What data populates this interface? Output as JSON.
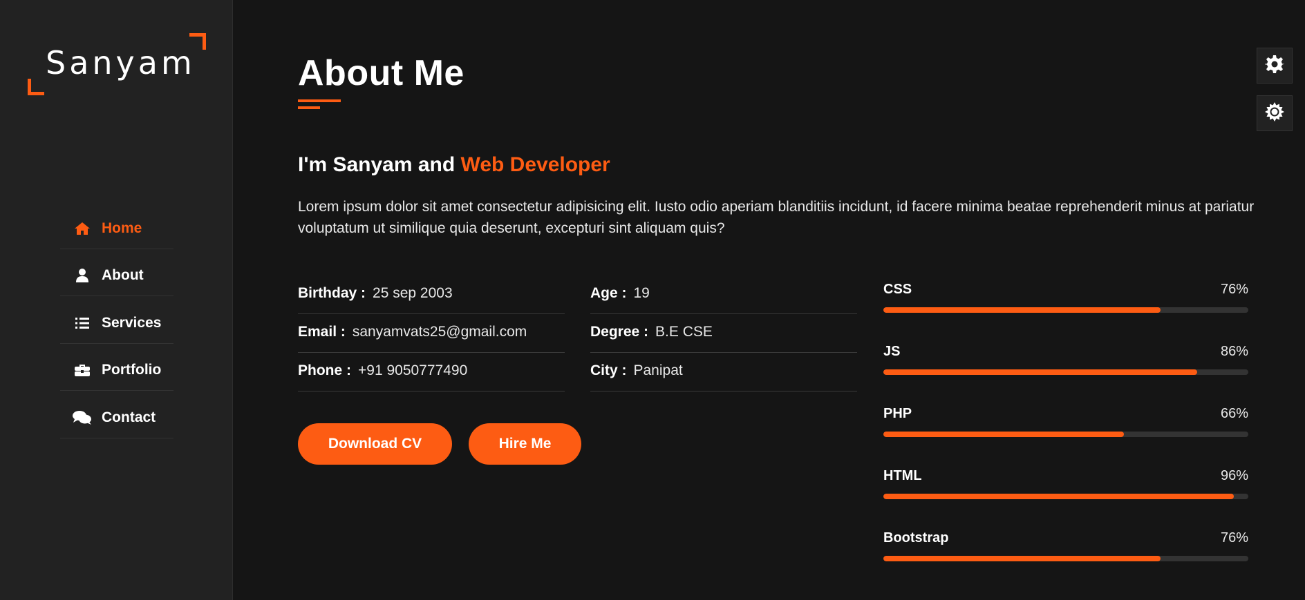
{
  "logo": {
    "text": "Sanyam"
  },
  "nav": [
    {
      "label": "Home",
      "icon": "home-icon",
      "active": true
    },
    {
      "label": "About",
      "icon": "user-icon",
      "active": false
    },
    {
      "label": "Services",
      "icon": "list-icon",
      "active": false
    },
    {
      "label": "Portfolio",
      "icon": "briefcase-icon",
      "active": false
    },
    {
      "label": "Contact",
      "icon": "comments-icon",
      "active": false
    }
  ],
  "about": {
    "title": "About Me",
    "intro_prefix": "I'm Sanyam and ",
    "intro_accent": "Web Developer",
    "description": "Lorem ipsum dolor sit amet consectetur adipisicing elit. Iusto odio aperiam blanditiis incidunt, id facere minima beatae reprehenderit minus at pariatur voluptatum ut similique quia deserunt, excepturi sint aliquam quis?"
  },
  "info": {
    "birthday_label": "Birthday :",
    "birthday": "25 sep 2003",
    "email_label": "Email :",
    "email": "sanyamvats25@gmail.com",
    "phone_label": "Phone :",
    "phone": "+91 9050777490",
    "age_label": "Age :",
    "age": "19",
    "degree_label": "Degree :",
    "degree": "B.E CSE",
    "city_label": "City :",
    "city": "Panipat"
  },
  "buttons": {
    "download": "Download CV",
    "hire": "Hire Me"
  },
  "skills": [
    {
      "name": "CSS",
      "percent_label": "76%",
      "value": 76
    },
    {
      "name": "JS",
      "percent_label": "86%",
      "value": 86
    },
    {
      "name": "PHP",
      "percent_label": "66%",
      "value": 66
    },
    {
      "name": "HTML",
      "percent_label": "96%",
      "value": 96
    },
    {
      "name": "Bootstrap",
      "percent_label": "76%",
      "value": 76
    }
  ],
  "colors": {
    "accent": "#fd5c13",
    "background": "#151515",
    "sidebar": "#222222"
  },
  "style_switcher": {
    "settings_icon": "gear-icon",
    "theme_icon": "sun-icon"
  }
}
